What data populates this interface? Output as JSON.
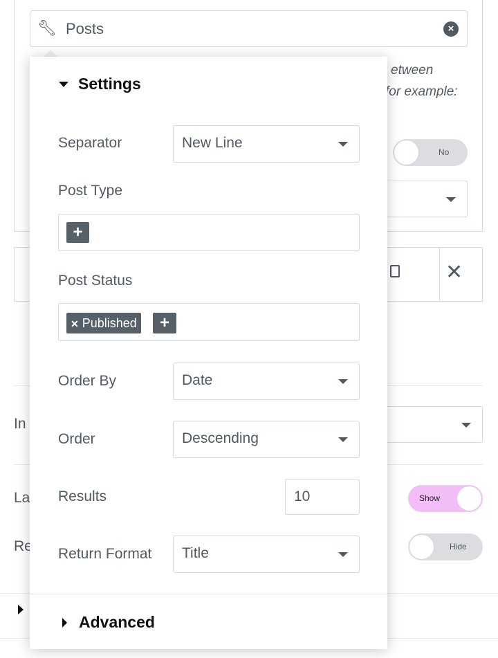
{
  "source_field": {
    "value": "Posts",
    "icon": "wrench-icon",
    "clear_icon": "clear-circle-icon"
  },
  "background": {
    "description_fragment_1": "etween",
    "description_fragment_2": "for example:",
    "toggle_no": "No",
    "label_in": "In",
    "label_la": "La",
    "label_re": "Re",
    "toggle_show": "Show",
    "toggle_hide": "Hide",
    "accent_color": "#f3bdf8"
  },
  "popup": {
    "settings_title": "Settings",
    "advanced_title": "Advanced",
    "separator": {
      "label": "Separator",
      "value": "New Line"
    },
    "post_type": {
      "label": "Post Type"
    },
    "post_status": {
      "label": "Post Status",
      "tags": [
        "Published"
      ]
    },
    "order_by": {
      "label": "Order By",
      "value": "Date"
    },
    "order": {
      "label": "Order",
      "value": "Descending"
    },
    "results": {
      "label": "Results",
      "value": "10"
    },
    "return_format": {
      "label": "Return Format",
      "value": "Title"
    }
  }
}
